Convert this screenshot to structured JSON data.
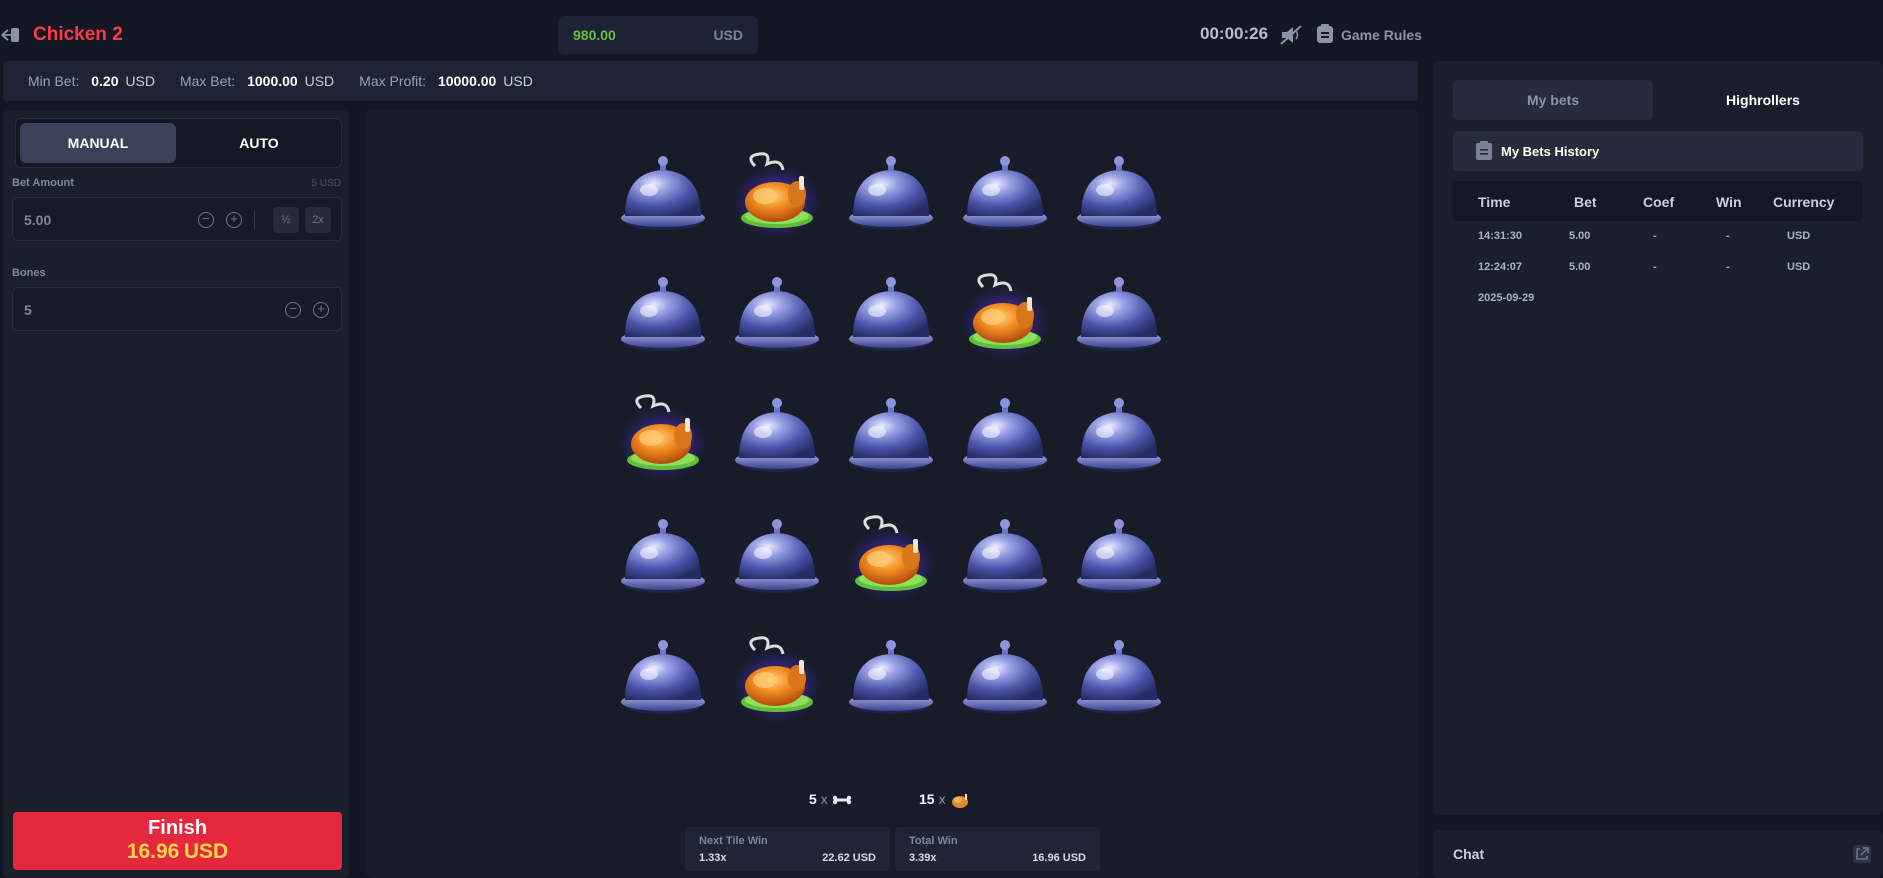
{
  "header": {
    "title": "Chicken 2",
    "balance": "980.00",
    "currency": "USD",
    "timer": "00:00:26",
    "rules_label": "Game Rules"
  },
  "limits": [
    {
      "label": "Min Bet:",
      "value": "0.20",
      "unit": "USD"
    },
    {
      "label": "Max Bet:",
      "value": "1000.00",
      "unit": "USD"
    },
    {
      "label": "Max Profit:",
      "value": "10000.00",
      "unit": "USD"
    }
  ],
  "controls": {
    "manual_label": "MANUAL",
    "auto_label": "AUTO",
    "active_mode": "MANUAL",
    "bet_amount_label": "Bet Amount",
    "bet_amount_hint": "5 USD",
    "bet_amount_value": "5.00",
    "half_label": "½",
    "double_label": "2x",
    "bones_label": "Bones",
    "bones_value": "5",
    "finish_label": "Finish",
    "finish_amount": "16.96",
    "finish_currency": "USD"
  },
  "board": {
    "rows": 5,
    "cols": 5,
    "tiles": [
      [
        "cloche",
        "chicken",
        "cloche",
        "cloche",
        "cloche"
      ],
      [
        "cloche",
        "cloche",
        "cloche",
        "chicken",
        "cloche"
      ],
      [
        "chicken",
        "cloche",
        "cloche",
        "cloche",
        "cloche"
      ],
      [
        "cloche",
        "cloche",
        "chicken",
        "cloche",
        "cloche"
      ],
      [
        "cloche",
        "chicken",
        "cloche",
        "cloche",
        "cloche"
      ]
    ],
    "bones_count": "5",
    "chickens_count": "15",
    "times_label": "x",
    "next_tile_win": {
      "title": "Next Tile Win",
      "coef": "1.33x",
      "amount": "22.62 USD"
    },
    "total_win": {
      "title": "Total Win",
      "coef": "3.39x",
      "amount": "16.96 USD"
    }
  },
  "sidebar": {
    "tab_my_bets": "My bets",
    "tab_highrollers": "Highrollers",
    "history_label": "My Bets History",
    "columns": [
      "Time",
      "Bet",
      "Coef",
      "Win",
      "Currency"
    ],
    "rows": [
      {
        "time": "14:31:30",
        "bet": "5.00",
        "coef": "-",
        "win": "-",
        "currency": "USD"
      },
      {
        "time": "12:24:07",
        "bet": "5.00",
        "coef": "-",
        "win": "-",
        "currency": "USD"
      }
    ],
    "date_label": "2025-09-29",
    "chat_label": "Chat"
  },
  "colors": {
    "brand_red": "#ff3a48",
    "finish_button": "#e6283f",
    "finish_amount": "#ffd84a",
    "balance_green": "#6bbf49",
    "cloche": "#5a63b8",
    "chicken_glow": "#6a3dff"
  }
}
